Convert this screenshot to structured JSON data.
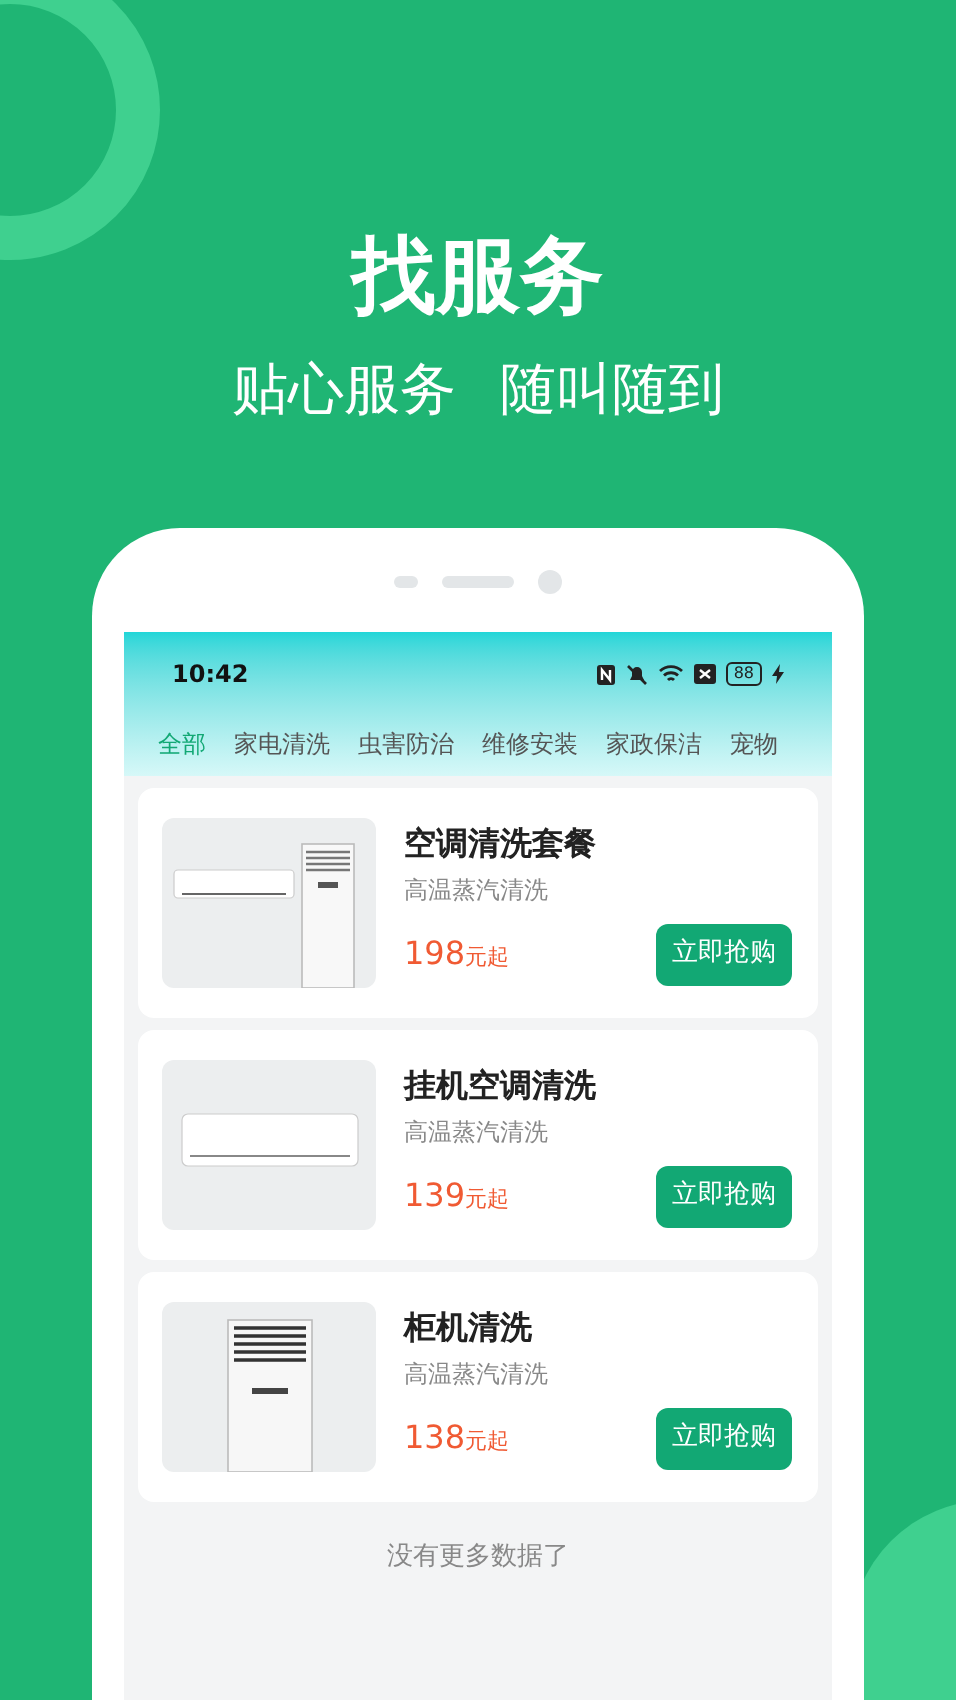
{
  "headline": "找服务",
  "tagline": [
    "贴心服务",
    "随叫随到"
  ],
  "status_bar": {
    "time": "10:42",
    "battery": "88"
  },
  "tabs": [
    {
      "label": "全部",
      "selected": true
    },
    {
      "label": "家电清洗",
      "selected": false
    },
    {
      "label": "虫害防治",
      "selected": false
    },
    {
      "label": "维修安装",
      "selected": false
    },
    {
      "label": "家政保洁",
      "selected": false
    },
    {
      "label": "宠物",
      "selected": false
    }
  ],
  "products": [
    {
      "kind": "combo",
      "title": "空调清洗套餐",
      "subtitle": "高温蒸汽清洗",
      "price": "198",
      "unit": "元起",
      "button": "立即抢购"
    },
    {
      "kind": "wall",
      "title": "挂机空调清洗",
      "subtitle": "高温蒸汽清洗",
      "price": "139",
      "unit": "元起",
      "button": "立即抢购"
    },
    {
      "kind": "tower",
      "title": "柜机清洗",
      "subtitle": "高温蒸汽清洗",
      "price": "138",
      "unit": "元起",
      "button": "立即抢购"
    }
  ],
  "footer": "没有更多数据了"
}
